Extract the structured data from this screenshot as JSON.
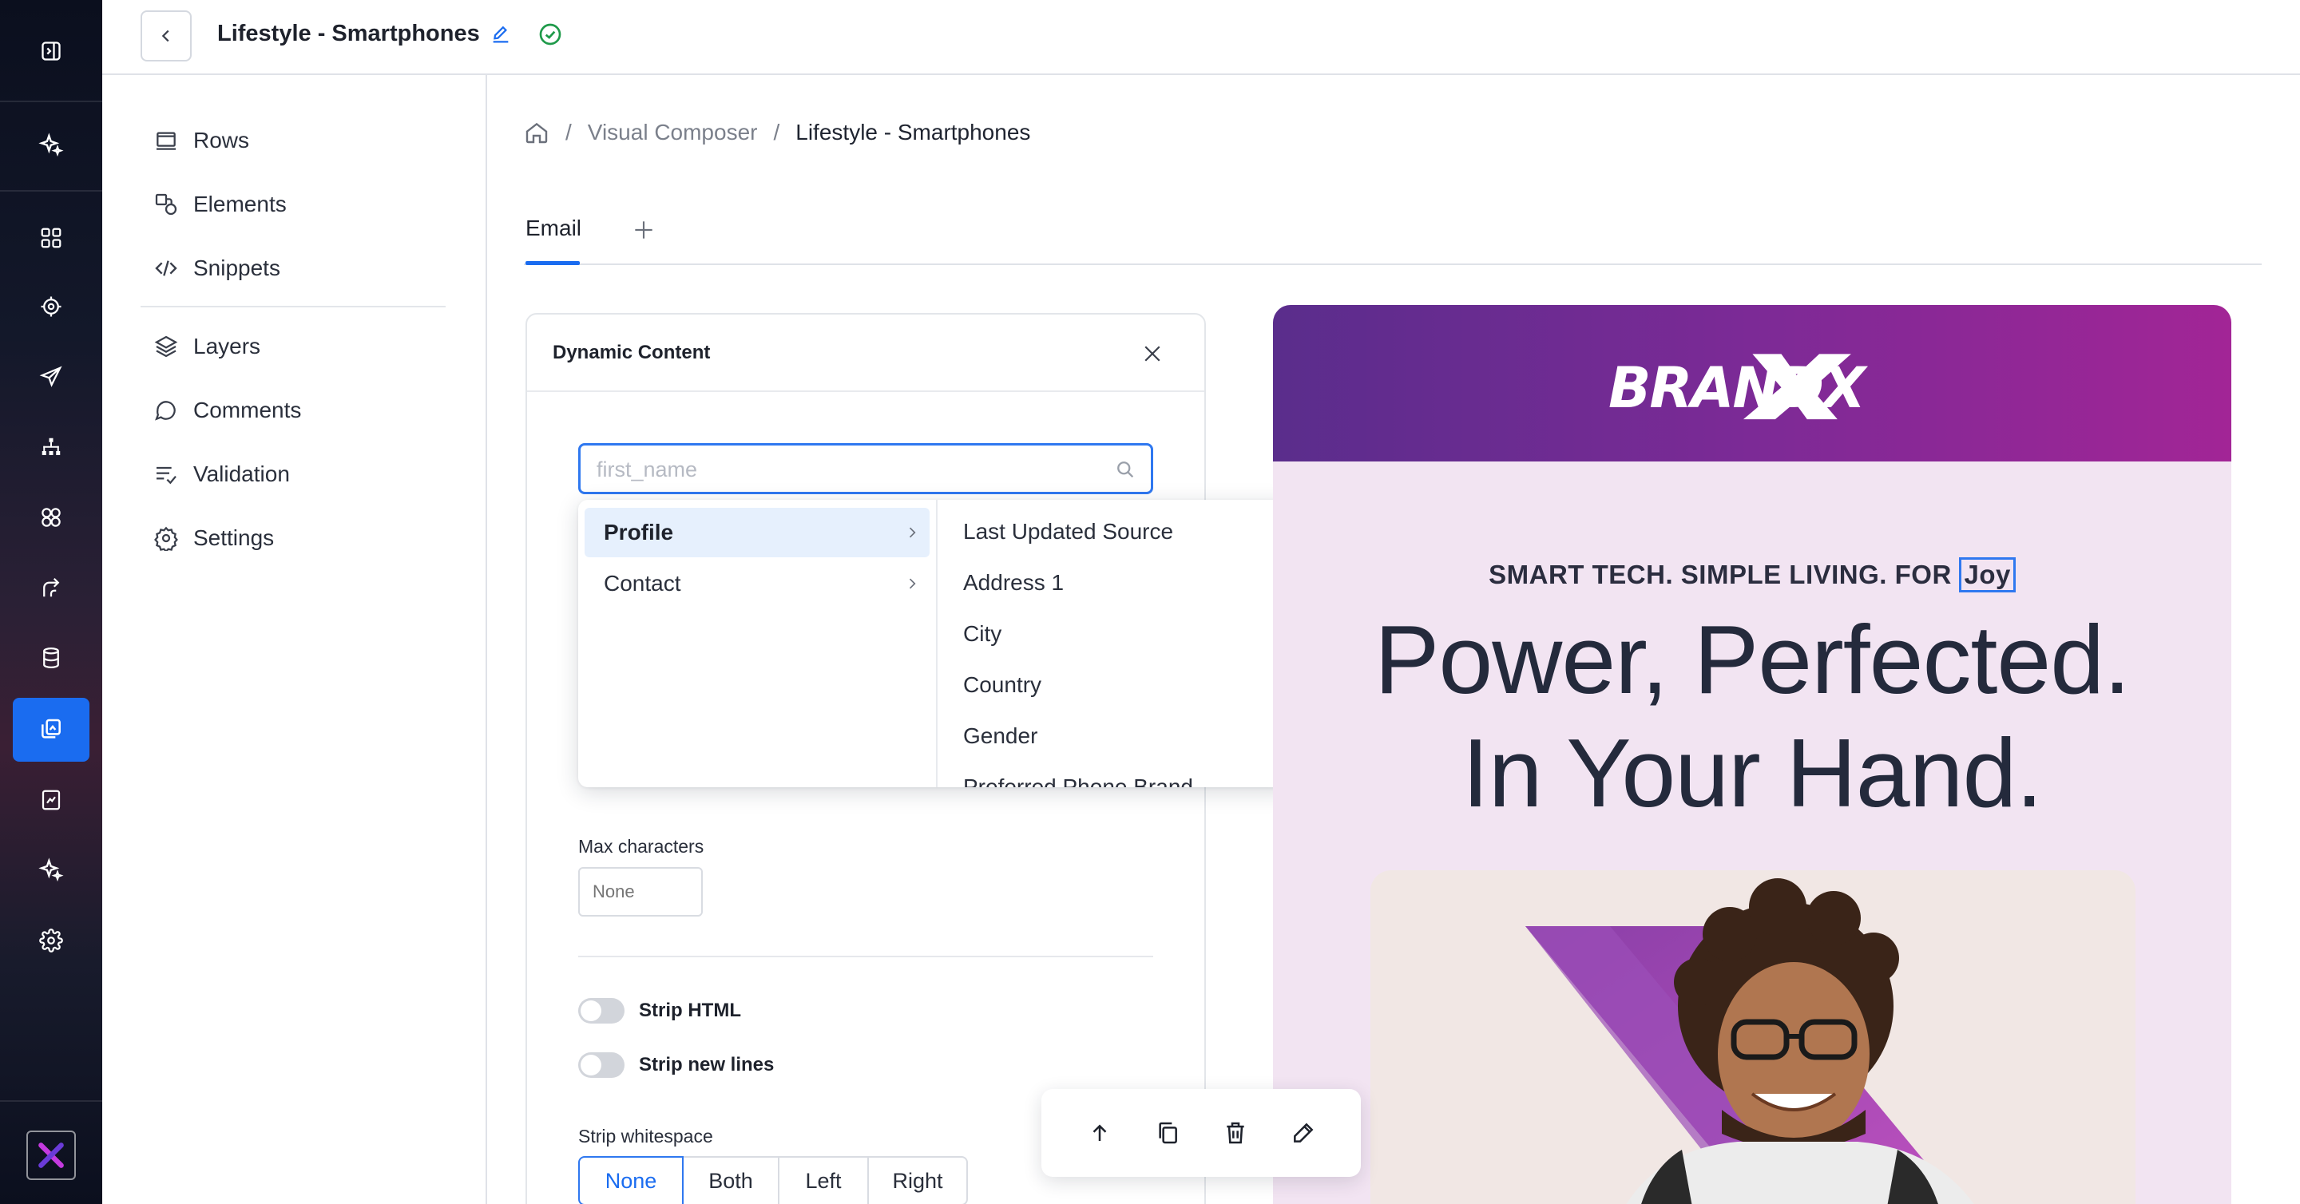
{
  "header": {
    "title": "Lifestyle - Smartphones"
  },
  "left_menu": {
    "items": [
      {
        "label": "Rows",
        "icon": "rows-icon"
      },
      {
        "label": "Elements",
        "icon": "elements-icon"
      },
      {
        "label": "Snippets",
        "icon": "code-icon"
      },
      {
        "label": "Layers",
        "icon": "layers-icon"
      },
      {
        "label": "Comments",
        "icon": "comment-icon"
      },
      {
        "label": "Validation",
        "icon": "checklist-icon"
      },
      {
        "label": "Settings",
        "icon": "gear-icon"
      }
    ]
  },
  "breadcrumb": {
    "items": [
      "Visual Composer",
      "Lifestyle - Smartphones"
    ],
    "separator": "/"
  },
  "tabs": {
    "items": [
      {
        "label": "Email"
      }
    ]
  },
  "dynamic_content": {
    "title": "Dynamic Content",
    "search_placeholder": "first_name",
    "categories": [
      {
        "label": "Profile",
        "active": true
      },
      {
        "label": "Contact",
        "active": false
      }
    ],
    "fields": [
      "Last Updated Source",
      "Address 1",
      "City",
      "Country",
      "Gender",
      "Preferred Phone Brand"
    ],
    "max_characters_label": "Max characters",
    "max_characters_placeholder": "None",
    "strip_html_label": "Strip HTML",
    "strip_new_lines_label": "Strip new lines",
    "strip_whitespace_label": "Strip whitespace",
    "strip_whitespace_options": [
      "None",
      "Both",
      "Left",
      "Right"
    ],
    "strip_whitespace_selected": "None"
  },
  "preview": {
    "brand": "BRANDX",
    "pre_tag": "SMART TECH. SIMPLE LIVING. FOR",
    "pre_tag_token": "Joy",
    "headline_1": "Power, Perfected.",
    "headline_2": "In Your Hand."
  },
  "colors": {
    "accent": "#1a6cf0",
    "saved_check": "#1f9a4a",
    "brand_gradient_start": "#5a2d8c",
    "brand_gradient_end": "#a22596",
    "email_bg": "#f2e4f2"
  }
}
